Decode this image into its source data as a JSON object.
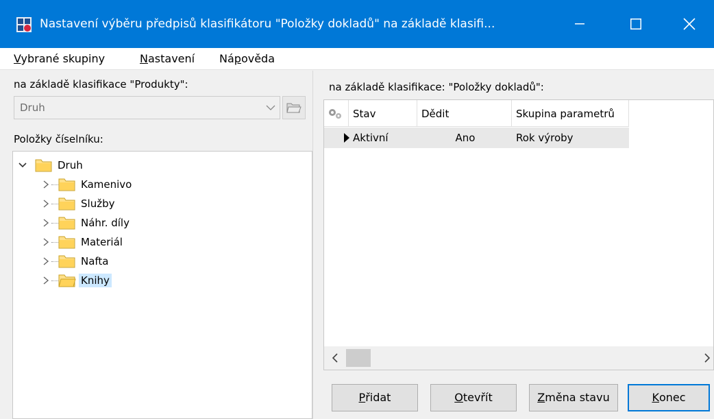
{
  "window": {
    "title": "Nastavení výběru předpisů klasifikátoru \"Položky dokladů\" na základě klasifi...",
    "app_icon": "app-icon",
    "controls": [
      "minimize-icon",
      "maximize-icon",
      "close-icon"
    ],
    "accent_color": "#0078d7"
  },
  "menu": {
    "items": [
      {
        "underline": "V",
        "rest": "ybrané skupiny"
      },
      {
        "underline": "N",
        "rest": "astavení"
      },
      {
        "prefix": "Ná",
        "underline": "p",
        "rest": "ověda"
      }
    ]
  },
  "left": {
    "classification_label": "na základě klasifikace \"Produkty\":",
    "combo_value": "Druh",
    "items_label": "Položky číselníku:",
    "tree": {
      "root": "Druh",
      "children": [
        "Kamenivo",
        "Služby",
        "Náhr. díly",
        "Materiál",
        "Nafta",
        "Knihy"
      ],
      "selected": "Knihy"
    }
  },
  "right": {
    "classification_label": "na základě klasifikace: \"Položky dokladů\":",
    "grid": {
      "columns": [
        "Stav",
        "Dědit",
        "Skupina parametrů"
      ],
      "rows": [
        {
          "stav": "Aktivní",
          "dedit": "Ano",
          "skupina": "Rok výroby"
        }
      ]
    }
  },
  "buttons": {
    "add": {
      "underline": "P",
      "rest": "řidat"
    },
    "open": {
      "underline": "O",
      "rest": "tevřít"
    },
    "change_state": {
      "underline": "Z",
      "rest": "měna stavu"
    },
    "close": {
      "underline": "K",
      "rest": "onec"
    }
  }
}
